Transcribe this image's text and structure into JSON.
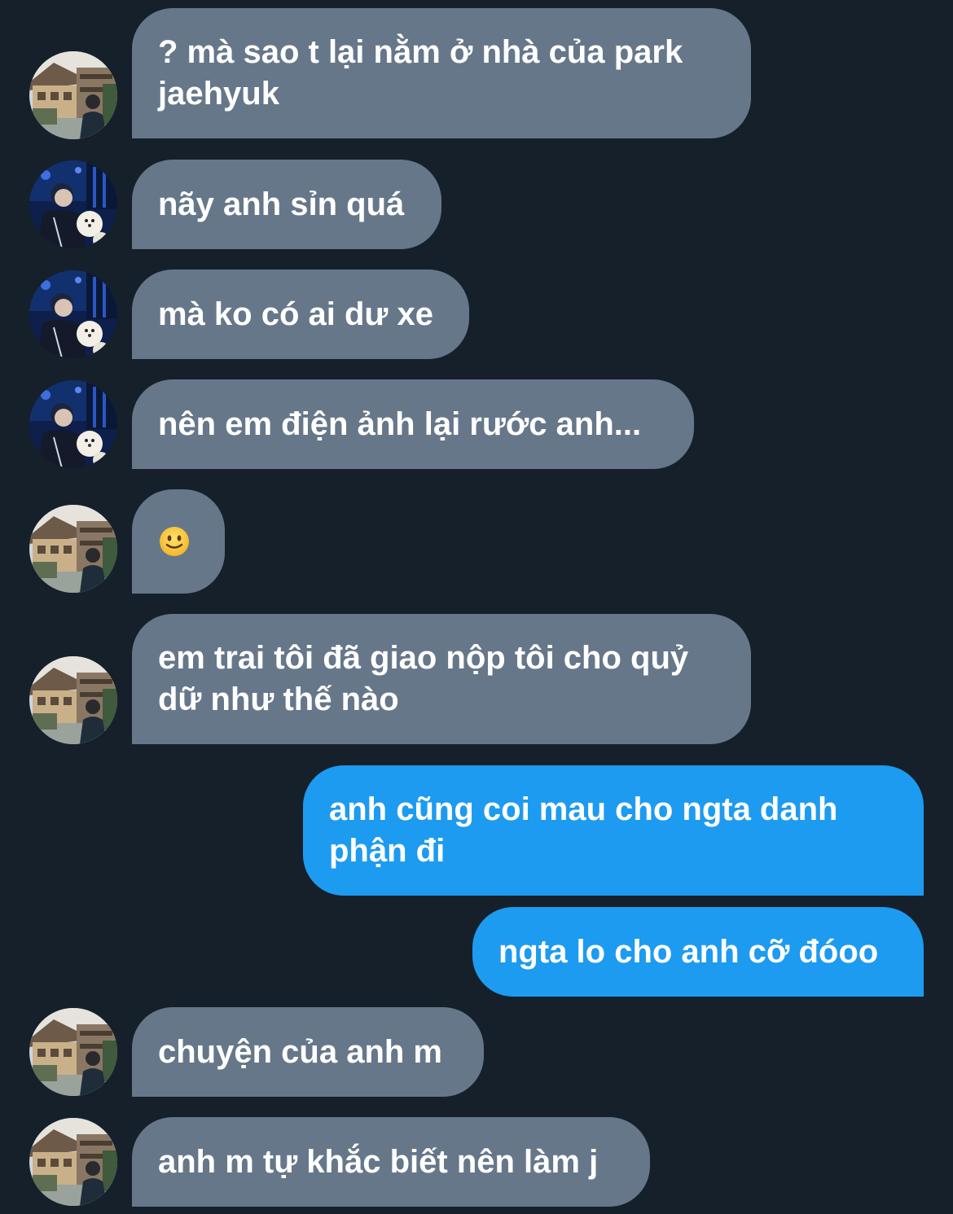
{
  "messages": [
    {
      "from": "other",
      "avatar": "house-avatar",
      "text": "? mà sao t lại nằm ở nhà của park jaehyuk"
    },
    {
      "from": "other",
      "avatar": "night-avatar",
      "text": "nãy anh sỉn quá"
    },
    {
      "from": "other",
      "avatar": "night-avatar",
      "text": "mà ko có ai dư xe"
    },
    {
      "from": "other",
      "avatar": "night-avatar",
      "text": "nên em điện ảnh lại rước anh..."
    },
    {
      "from": "other",
      "avatar": "house-avatar",
      "text": "",
      "emoji": "slightly-smiling-face-emoji"
    },
    {
      "from": "other",
      "avatar": "house-avatar",
      "text": "em trai tôi đã giao nộp tôi cho quỷ dữ như thế nào"
    },
    {
      "from": "me",
      "text": "anh cũng coi mau cho ngta danh phận đi"
    },
    {
      "from": "me",
      "text": "ngta lo cho anh cỡ đóoo"
    },
    {
      "from": "other",
      "avatar": "house-avatar",
      "text": "chuyện của anh m"
    },
    {
      "from": "other",
      "avatar": "house-avatar",
      "text": "anh m tự khắc biết nên làm j"
    }
  ],
  "colors": {
    "background": "#15202b",
    "incoming_bubble": "#66778a",
    "outgoing_bubble": "#1d9bf0",
    "text": "#ffffff"
  }
}
